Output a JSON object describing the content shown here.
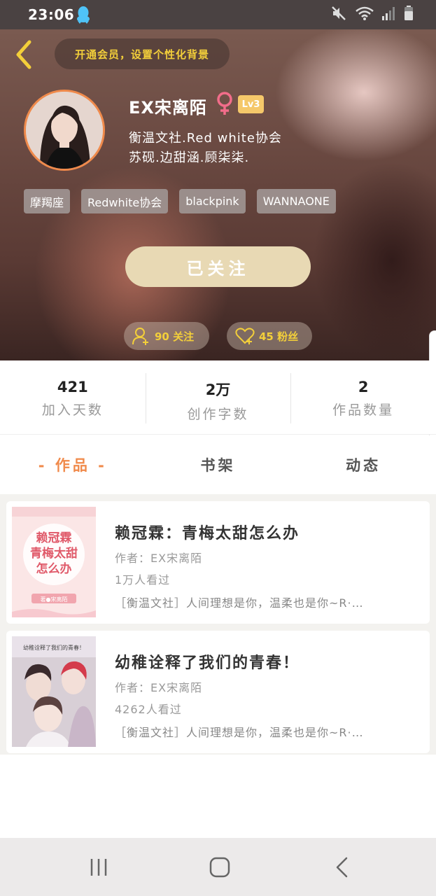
{
  "status_bar": {
    "time": "23:06"
  },
  "header": {
    "vip_prompt": "开通会员，设置个性化背景",
    "name": "EX宋离陌",
    "level": "Lv3",
    "bio_line1": "衡温文社.Red white协会",
    "bio_line2": "苏砚.边甜涵.顾柒柒.",
    "tags": [
      "摩羯座",
      "Redwhite协会",
      "blackpink",
      "WANNAONE"
    ],
    "follow_button": "已关注",
    "following_label": "90 关注",
    "fans_label": "45 粉丝"
  },
  "stats": [
    {
      "value": "421",
      "label": "加入天数"
    },
    {
      "value": "2万",
      "label": "创作字数"
    },
    {
      "value": "2",
      "label": "作品数量"
    }
  ],
  "tabs": [
    {
      "label": "- 作品 -",
      "active": true
    },
    {
      "label": "书架",
      "active": false
    },
    {
      "label": "动态",
      "active": false
    }
  ],
  "works": [
    {
      "title": "赖冠霖：青梅太甜怎么办",
      "author": "作者：EX宋离陌",
      "reads": "1万人看过",
      "desc": "［衡温文社］人间理想是你，温柔也是你~R·…",
      "cover_text": [
        "赖冠霖",
        "青梅太甜",
        "怎么办"
      ],
      "cover_badge": "著●宋离陌"
    },
    {
      "title": "幼稚诠释了我们的青春！",
      "author": "作者：EX宋离陌",
      "reads": "4262人看过",
      "desc": "［衡温文社］人间理想是你，温柔也是你~R·…",
      "cover_text": [
        "幼稚诠释了我们的青春！"
      ]
    }
  ],
  "colors": {
    "accent": "#f08a4b",
    "gold": "#f3cf3a",
    "follow_btn": "#e8d9b4",
    "level_badge": "#f5c86a"
  }
}
